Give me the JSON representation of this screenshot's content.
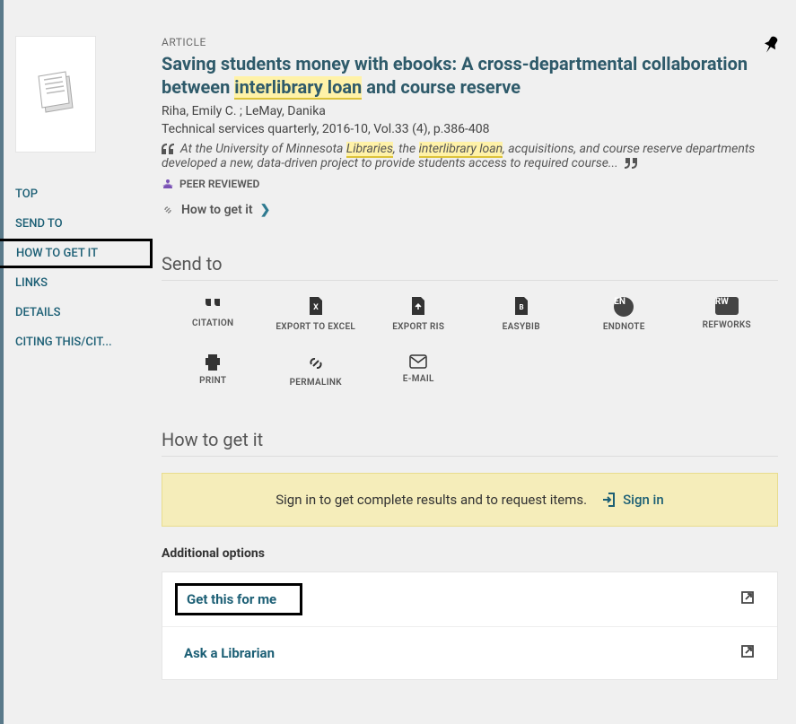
{
  "record": {
    "type_label": "ARTICLE",
    "title_pre": "Saving students money with ebooks: A cross-departmental collaboration between ",
    "title_hl": "interlibrary loan",
    "title_post": " and course reserve",
    "authors": "Riha, Emily C. ; LeMay, Danika",
    "source": "Technical services quarterly, 2016-10, Vol.33 (4), p.386-408",
    "snippet_pre": "At the University of Minnesota ",
    "snippet_hl1": "Libraries",
    "snippet_mid": ", the ",
    "snippet_hl2": "interlibrary loan",
    "snippet_post": ", acquisitions, and course reserve departments developed a new, data-driven project to provide students access to required course...",
    "peer_reviewed": "PEER REVIEWED",
    "how_link": "How to get it"
  },
  "nav": {
    "items": [
      "TOP",
      "SEND TO",
      "HOW TO GET IT",
      "LINKS",
      "DETAILS",
      "CITING THIS/CIT..."
    ]
  },
  "send_to": {
    "heading": "Send to",
    "items": [
      "CITATION",
      "EXPORT TO EXCEL",
      "EXPORT RIS",
      "EASYBIB",
      "ENDNOTE",
      "REFWORKS",
      "PRINT",
      "PERMALINK",
      "E-MAIL"
    ],
    "endnote_badge": "EN",
    "refworks_badge": "RW"
  },
  "how_section": {
    "heading": "How to get it",
    "banner_text": "Sign in to get complete results and to request items.",
    "sign_in": "Sign in",
    "additional": "Additional options",
    "options": [
      "Get this for me",
      "Ask a Librarian"
    ]
  }
}
